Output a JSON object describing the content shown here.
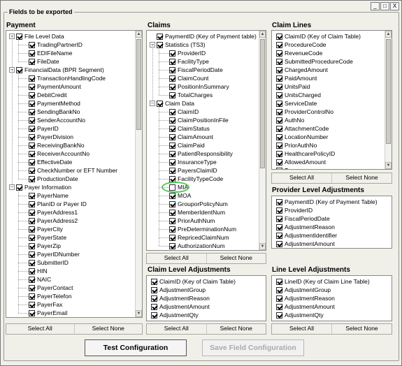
{
  "window": {
    "min": "_",
    "max": "□",
    "close": "X"
  },
  "group_title": "Fields to be exported",
  "payment": {
    "title": "Payment",
    "rows": [
      {
        "t": "root",
        "label": "File Level Data",
        "checked": true
      },
      {
        "t": "leaf",
        "label": "TradingPartnerID",
        "checked": true
      },
      {
        "t": "leaf",
        "label": "EDIFileName",
        "checked": true
      },
      {
        "t": "leaf",
        "label": "FileDate",
        "checked": true
      },
      {
        "t": "root",
        "label": "FinancialData (BPR Segment)",
        "checked": true
      },
      {
        "t": "leaf",
        "label": "TransactionHandlingCode",
        "checked": true
      },
      {
        "t": "leaf",
        "label": "PaymentAmount",
        "checked": true
      },
      {
        "t": "leaf",
        "label": "DebitCredit",
        "checked": true
      },
      {
        "t": "leaf",
        "label": "PaymentMethod",
        "checked": true
      },
      {
        "t": "leaf",
        "label": "SendingBankNo",
        "checked": true
      },
      {
        "t": "leaf",
        "label": "SenderAccountNo",
        "checked": true
      },
      {
        "t": "leaf",
        "label": "PayerID",
        "checked": true
      },
      {
        "t": "leaf",
        "label": "PayerDivision",
        "checked": true
      },
      {
        "t": "leaf",
        "label": "ReceivingBankNo",
        "checked": true
      },
      {
        "t": "leaf",
        "label": "ReceiverAccountNo",
        "checked": true
      },
      {
        "t": "leaf",
        "label": "EffectiveDate",
        "checked": true
      },
      {
        "t": "leaf",
        "label": "CheckNumber or EFT Number",
        "checked": true
      },
      {
        "t": "leaf",
        "label": "ProductionDate",
        "checked": true
      },
      {
        "t": "root",
        "label": "Payer Information",
        "checked": true
      },
      {
        "t": "leaf",
        "label": "PayerName",
        "checked": true
      },
      {
        "t": "leaf",
        "label": "PlanID or Payer ID",
        "checked": true
      },
      {
        "t": "leaf",
        "label": "PayerAddress1",
        "checked": true
      },
      {
        "t": "leaf",
        "label": "PayerAddress2",
        "checked": true
      },
      {
        "t": "leaf",
        "label": "PayerCity",
        "checked": true
      },
      {
        "t": "leaf",
        "label": "PayerState",
        "checked": true
      },
      {
        "t": "leaf",
        "label": "PayerZip",
        "checked": true
      },
      {
        "t": "leaf",
        "label": "PayerIDNumber",
        "checked": true
      },
      {
        "t": "leaf",
        "label": "SubmitterID",
        "checked": true
      },
      {
        "t": "leaf",
        "label": "HIN",
        "checked": true
      },
      {
        "t": "leaf",
        "label": "NAIC",
        "checked": true
      },
      {
        "t": "leaf",
        "label": "PayerContact",
        "checked": true
      },
      {
        "t": "leaf",
        "label": "PayerTelefon",
        "checked": true
      },
      {
        "t": "leaf",
        "label": "PayerFax",
        "checked": true
      },
      {
        "t": "leaf",
        "label": "PayerEmail",
        "checked": true
      }
    ],
    "select_all": "Select All",
    "select_none": "Select None"
  },
  "claims": {
    "title": "Claims",
    "rows": [
      {
        "t": "top",
        "label": "PaymentID (Key of Payment table)",
        "checked": true
      },
      {
        "t": "root",
        "label": "Statistics (TS3)",
        "checked": true
      },
      {
        "t": "leaf",
        "label": "ProviderID",
        "checked": true
      },
      {
        "t": "leaf",
        "label": "FacilityType",
        "checked": true
      },
      {
        "t": "leaf",
        "label": "FiscalPeriodDate",
        "checked": true
      },
      {
        "t": "leaf",
        "label": "ClaimCount",
        "checked": true
      },
      {
        "t": "leaf",
        "label": "PositionInSummary",
        "checked": true
      },
      {
        "t": "leaf",
        "label": "TotalCharges",
        "checked": true
      },
      {
        "t": "root",
        "label": "Claim Data",
        "checked": true
      },
      {
        "t": "leaf",
        "label": "ClaimID",
        "checked": true
      },
      {
        "t": "leaf",
        "label": "ClaimPositionInFile",
        "checked": true
      },
      {
        "t": "leaf",
        "label": "ClaimStatus",
        "checked": true
      },
      {
        "t": "leaf",
        "label": "ClaimAmount",
        "checked": true
      },
      {
        "t": "leaf",
        "label": "ClaimPaid",
        "checked": true
      },
      {
        "t": "leaf",
        "label": "PatientResponsibility",
        "checked": true
      },
      {
        "t": "leaf",
        "label": "InsuranceType",
        "checked": true
      },
      {
        "t": "leaf",
        "label": "PayersClaimID",
        "checked": true
      },
      {
        "t": "leaf",
        "label": "FacilityTypeCode",
        "checked": true
      },
      {
        "t": "leaf",
        "label": "MIA",
        "checked": false
      },
      {
        "t": "leaf",
        "label": "MOA",
        "checked": true
      },
      {
        "t": "leaf",
        "label": "GrouporPolicyNum",
        "checked": true
      },
      {
        "t": "leaf",
        "label": "MemberIdentNum",
        "checked": true
      },
      {
        "t": "leaf",
        "label": "PriorAuthNum",
        "checked": true
      },
      {
        "t": "leaf",
        "label": "PreDeterminationNum",
        "checked": true
      },
      {
        "t": "leaf",
        "label": "RepricedClaimNum",
        "checked": true
      },
      {
        "t": "leaf",
        "label": "AuthorizationNum",
        "checked": true
      }
    ],
    "select_all": "Select All",
    "select_none": "Select None"
  },
  "claim_lines": {
    "title": "Claim Lines",
    "rows": [
      "ClaimID (Key of Claim Table)",
      "ProcedureCode",
      "RevenueCode",
      "SubmittedProcedureCode",
      "ChargedAmount",
      "PaidAmount",
      "UnitsPaid",
      "UnitsCharged",
      "ServiceDate",
      "ProviderControlNo",
      "AuthNo",
      "AttachmentCode",
      "LocationNumber",
      "PriorAuthNo",
      "HealthcarePolicyID",
      "AllowedAmount",
      "Tax"
    ],
    "select_all": "Select All",
    "select_none": "Select None"
  },
  "provider_adj": {
    "title": "Provider Level Adjustments",
    "rows": [
      "PaymentID (Key of Payment Table)",
      "ProviderID",
      "FiscalPeriodDate",
      "AdjustmentReason",
      "AdjustmentIdentifier",
      "AdjustmentAmount"
    ]
  },
  "claim_adj": {
    "title": "Claim Level Adjustments",
    "rows": [
      "ClaimID (Key of Claim Table)",
      "AdjustmentGroup",
      "AdjustmentReason",
      "AdjustmentAmount",
      "AdjustmentQty"
    ],
    "select_all": "Select All",
    "select_none": "Select None"
  },
  "line_adj": {
    "title": "Line Level Adjustments",
    "rows": [
      "LineID (Key of Claim Line Table)",
      "AdjustmentGroup",
      "AdjustmentReason",
      "AdjustmentAmount",
      "AdjustmentQty"
    ],
    "select_all": "Select All",
    "select_none": "Select None"
  },
  "buttons": {
    "test": "Test Configuration",
    "save": "Save Field Configuration"
  },
  "colors": {
    "highlight": "#5bc15b",
    "disabled_text": "#aaaaaa"
  }
}
